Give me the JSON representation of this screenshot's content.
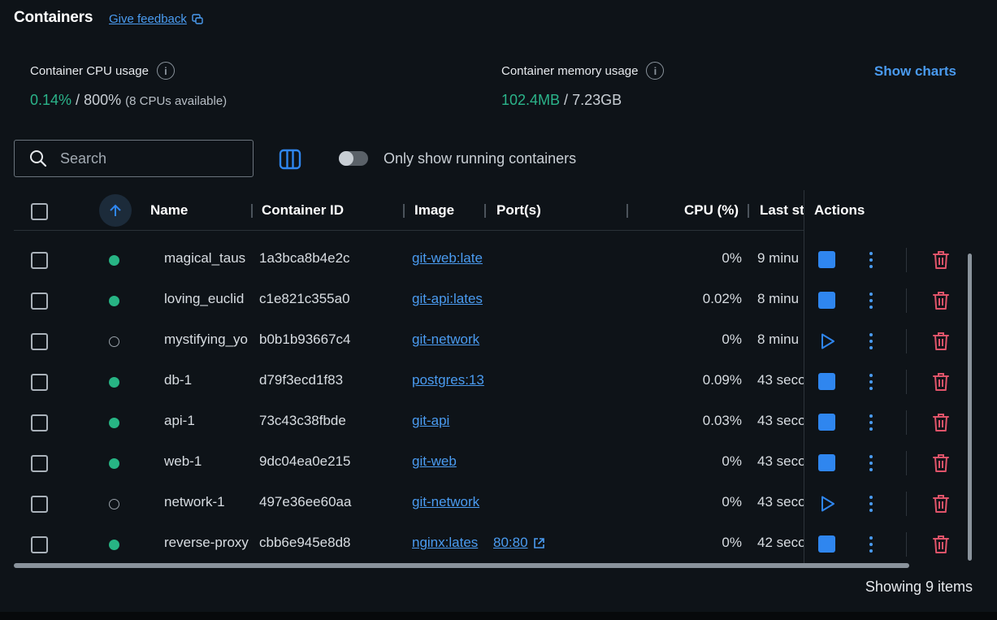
{
  "header": {
    "title": "Containers",
    "feedback_label": "Give feedback"
  },
  "stats": {
    "cpu_label": "Container CPU usage",
    "cpu_used": "0.14%",
    "cpu_sep": " / ",
    "cpu_total": "800%",
    "cpu_note": "(8 CPUs available)",
    "mem_label": "Container memory usage",
    "mem_used": "102.4MB",
    "mem_sep": " / ",
    "mem_total": "7.23GB",
    "show_charts": "Show charts"
  },
  "toolbar": {
    "search_placeholder": "Search",
    "toggle_label": "Only show running containers",
    "toggle_on": false
  },
  "table": {
    "columns": {
      "name": "Name",
      "id": "Container ID",
      "image": "Image",
      "ports": "Port(s)",
      "cpu": "CPU (%)",
      "last": "Last st",
      "actions": "Actions"
    },
    "rows": [
      {
        "name": "magical_taus",
        "id": "1a3bca8b4e2c",
        "image": "git-web:late",
        "port": "",
        "cpu": "0%",
        "last": "9 minu",
        "running": true
      },
      {
        "name": "loving_euclid",
        "id": "c1e821c355a0",
        "image": "git-api:lates",
        "port": "",
        "cpu": "0.02%",
        "last": "8 minu",
        "running": true
      },
      {
        "name": "mystifying_yo",
        "id": "b0b1b93667c4",
        "image": "git-network",
        "port": "",
        "cpu": "0%",
        "last": "8 minu",
        "running": false
      },
      {
        "name": "db-1",
        "id": "d79f3ecd1f83",
        "image": "postgres:13",
        "port": "",
        "cpu": "0.09%",
        "last": "43 seco",
        "running": true
      },
      {
        "name": "api-1",
        "id": "73c43c38fbde",
        "image": "git-api",
        "port": "",
        "cpu": "0.03%",
        "last": "43 seco",
        "running": true
      },
      {
        "name": "web-1",
        "id": "9dc04ea0e215",
        "image": "git-web",
        "port": "",
        "cpu": "0%",
        "last": "43 seco",
        "running": true
      },
      {
        "name": "network-1",
        "id": "497e36ee60aa",
        "image": "git-network",
        "port": "",
        "cpu": "0%",
        "last": "43 seco",
        "running": false
      },
      {
        "name": "reverse-proxy",
        "id": "cbb6e945e8d8",
        "image": "nginx:lates",
        "port": "80:80",
        "cpu": "0%",
        "last": "42 seco",
        "running": true
      }
    ]
  },
  "footer": {
    "showing": "Showing 9 items"
  },
  "colors": {
    "accent": "#2f86ef",
    "running": "#27b484",
    "delete": "#e0546a",
    "background": "#0e1318"
  }
}
